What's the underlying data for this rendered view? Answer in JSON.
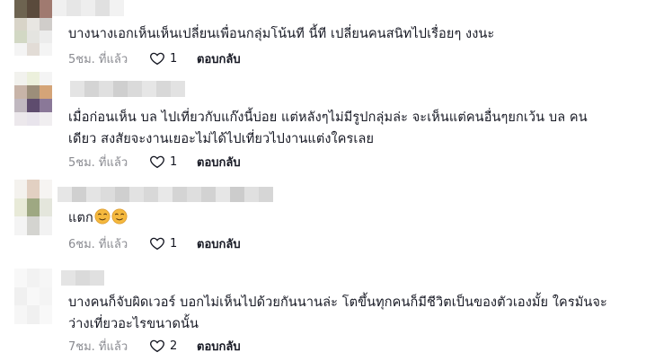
{
  "comments": [
    {
      "text": "บางนางเอกเห็นเห็นเปลี่ยนเพื่อนกลุ่มโน้นที นี้ที เปลี่ยนคนสนิทไปเรื่อยๆ งงนะ",
      "time": "5ชม. ที่แล้ว",
      "likes": "1",
      "reply": "ตอบกลับ"
    },
    {
      "text_line1": "เมื่อก่อนเห็น บล ไปเที่ยวกับแก๊งนี้บ่อย แต่หลังๆไม่มีรูปกลุ่มล่ะ จะเห็นแต่คนอื่นๆยกเว้น บล คน",
      "text_line2": "เดียว สงสัยจะงานเยอะไม่ได้ไปเที่ยวไปงานแต่งใครเลย",
      "time": "5ชม. ที่แล้ว",
      "likes": "1",
      "reply": "ตอบกลับ"
    },
    {
      "text": "แตก",
      "emoji": [
        "smirk-emoji",
        "smirk-emoji"
      ],
      "time": "6ชม. ที่แล้ว",
      "likes": "1",
      "reply": "ตอบกลับ"
    },
    {
      "text_line1": "บางคนก็จับผิดเวอร์ บอกไม่เห็นไปด้วยกันนานล่ะ โตขึ้นทุกคนก็มีชีวิตเป็นของตัวเองมั้ย ใครมันจะ",
      "text_line2": "ว่างเที่ยวอะไรขนาดนั้น",
      "time": "7ชม. ที่แล้ว",
      "likes": "2",
      "reply": "ตอบกลับ"
    }
  ],
  "icons": {
    "like": "heart-outline-icon"
  },
  "colors": {
    "text": "#161823",
    "meta": "#8a8b91",
    "emoji": "#f5b93e"
  }
}
